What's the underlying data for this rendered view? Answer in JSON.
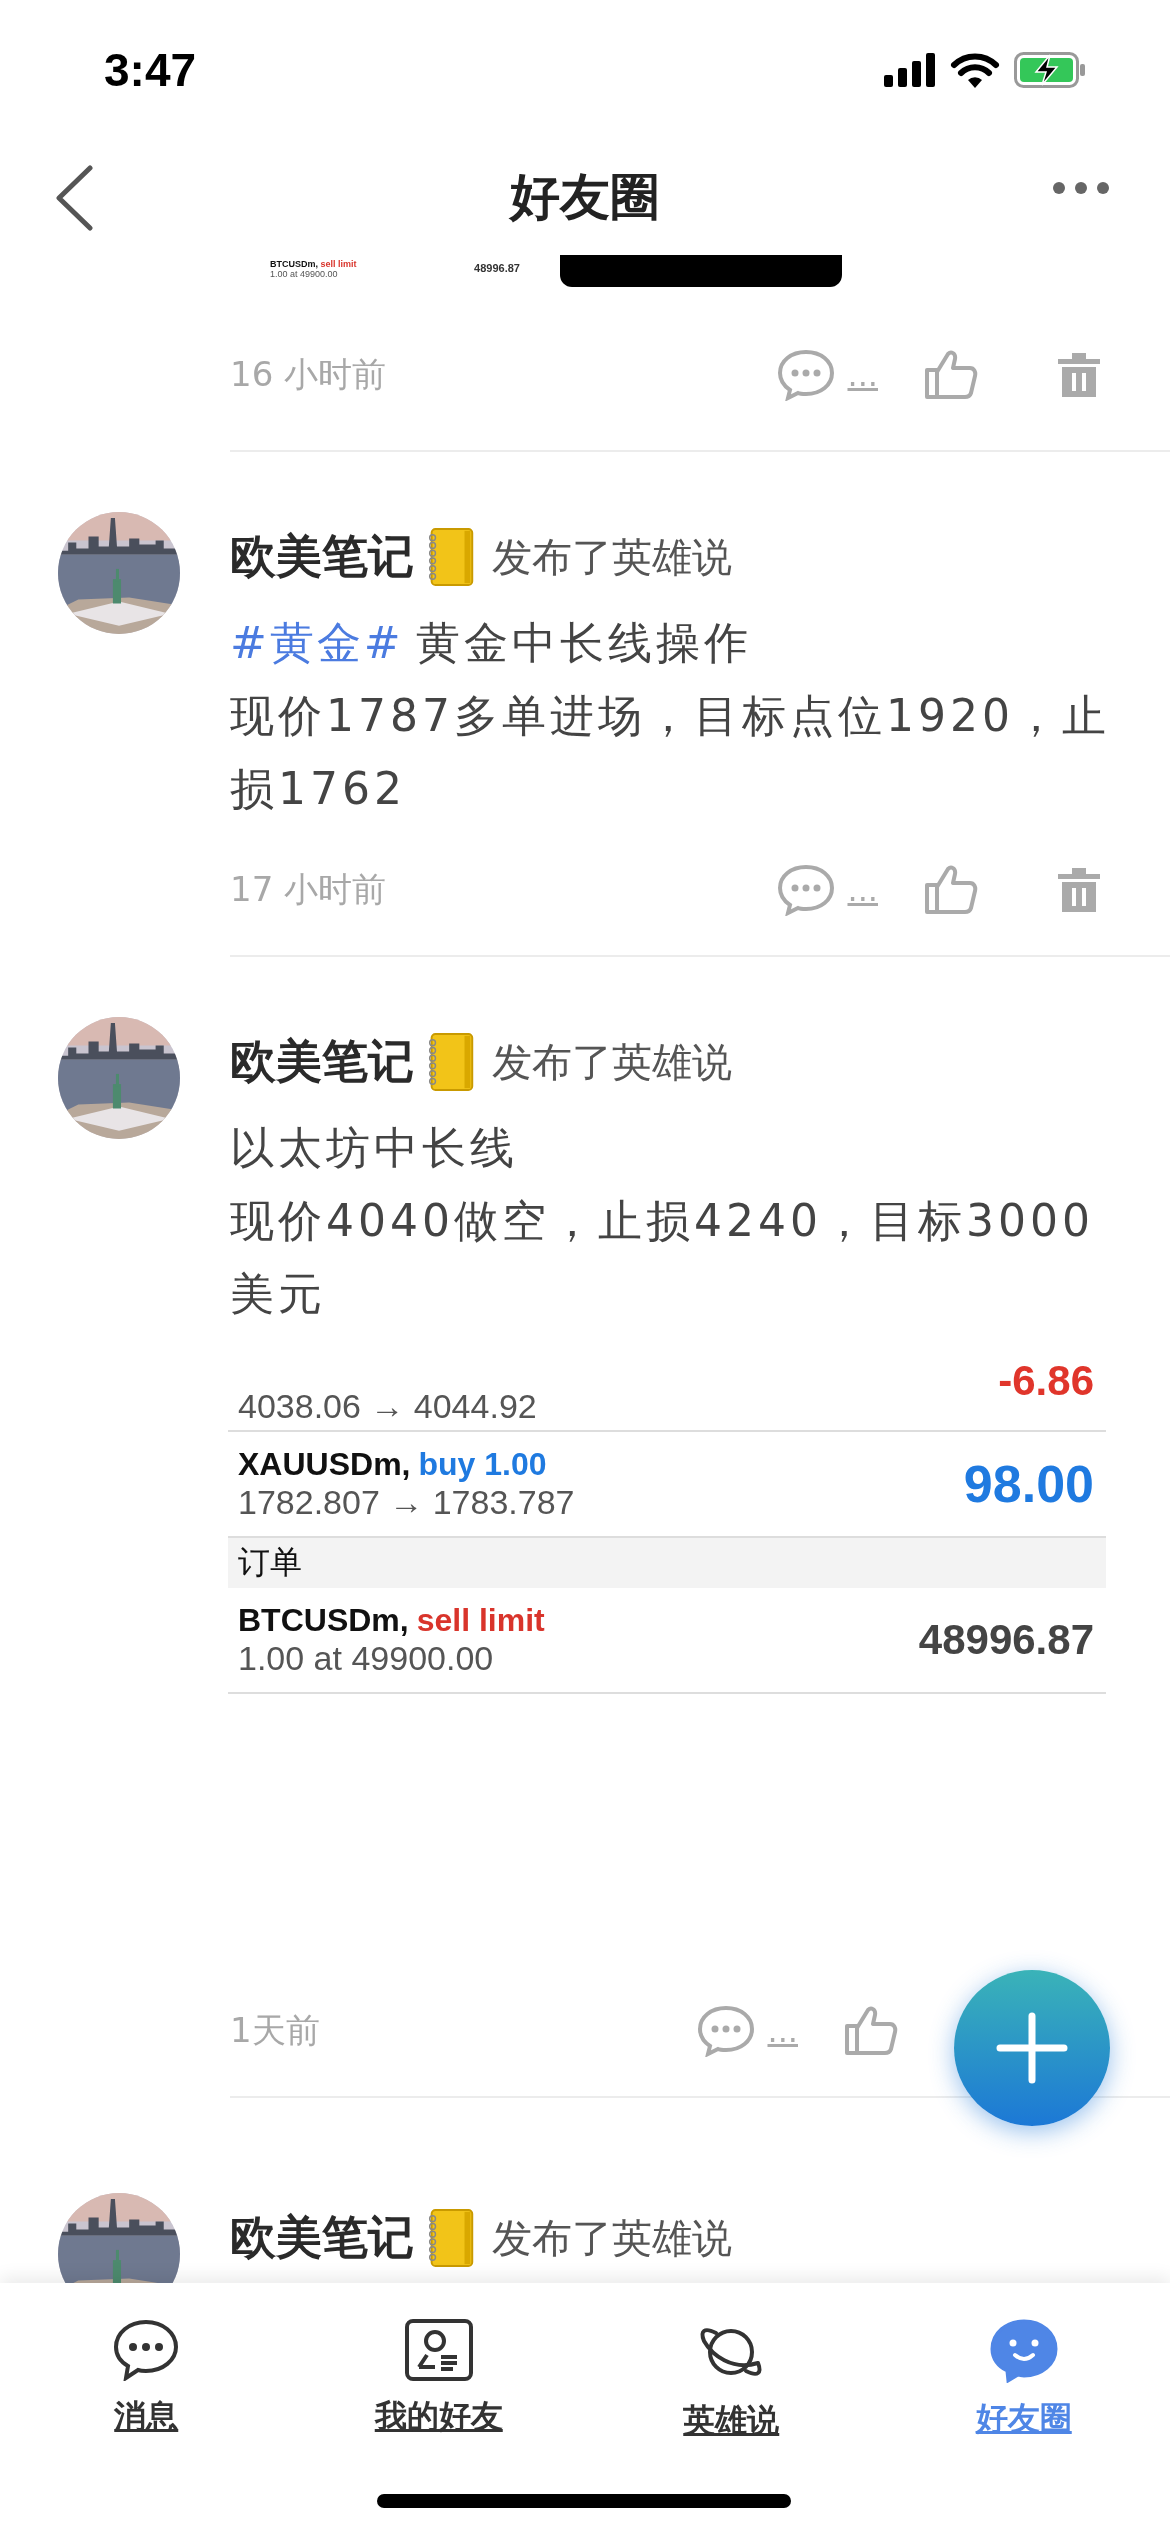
{
  "status_bar": {
    "time": "3:47"
  },
  "nav": {
    "title": "好友圈"
  },
  "posts": [
    {
      "kind": "tail",
      "strip": {
        "symbol": "BTCUSDm,",
        "order": "sell limit",
        "detail": "1.00 at 49900.00",
        "value": "48996.87"
      },
      "time": "16 小时前",
      "comment_label": "...",
      "delete": true
    },
    {
      "kind": "full",
      "author": "欧美笔记",
      "action": "发布了英雄说",
      "topic": "#黄金#",
      "lines": [
        "黄金中长线操作",
        "现价1787多单进场，目标点位1920，止损1762"
      ],
      "time": "17 小时前",
      "comment_label": "...",
      "delete": true
    },
    {
      "kind": "full",
      "author": "欧美笔记",
      "action": "发布了英雄说",
      "lines": [
        "以太坊中长线",
        "现价4040做空，止损4240，目标3000美元"
      ],
      "screenshot": {
        "rows": [
          {
            "kind": "cut",
            "prices": "4038.06 → 4044.92",
            "result": "-6.86",
            "color": "#e0352b"
          },
          {
            "kind": "trade",
            "symbol": "XAUUSDm,",
            "order": {
              "text": "buy 1.00",
              "color": "#1f7ae0"
            },
            "prices": "1782.807 → 1783.787",
            "result": "98.00",
            "color": "#1f7ae0"
          },
          {
            "kind": "header",
            "label": "订单"
          },
          {
            "kind": "trade",
            "symbol": "BTCUSDm,",
            "order": {
              "text": "sell limit",
              "color": "#d9342b"
            },
            "prices": "1.00 at 49900.00",
            "result": "48996.87",
            "color": "#444444"
          }
        ]
      },
      "time": "1天前",
      "comment_label": "...",
      "delete": false
    },
    {
      "kind": "head",
      "author": "欧美笔记",
      "action": "发布了英雄说"
    }
  ],
  "tabs": [
    {
      "label": "消息",
      "selected": false
    },
    {
      "label": "我的好友",
      "selected": false
    },
    {
      "label": "英雄说",
      "selected": false
    },
    {
      "label": "好友圈",
      "selected": true
    }
  ]
}
